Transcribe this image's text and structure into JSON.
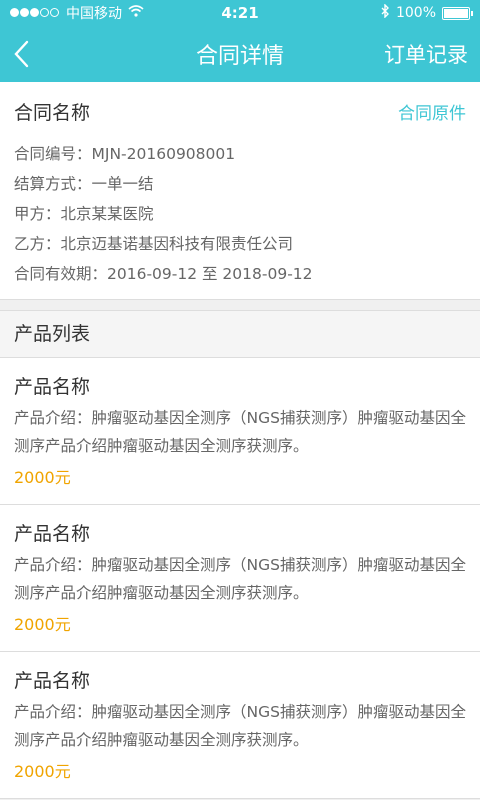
{
  "status": {
    "carrier": "中国移动",
    "time": "4:21",
    "battery": "100%"
  },
  "nav": {
    "title": "合同详情",
    "right_link": "订单记录"
  },
  "contract": {
    "name": "合同名称",
    "original_link": "合同原件",
    "rows": [
      "合同编号：MJN-20160908001",
      "结算方式：一单一结",
      "甲方：北京某某医院",
      "乙方：北京迈基诺基因科技有限责任公司",
      "合同有效期：2016-09-12 至 2018-09-12"
    ]
  },
  "product_list": {
    "heading": "产品列表",
    "items": [
      {
        "name": "产品名称",
        "desc": "产品介绍：肿瘤驱动基因全测序（NGS捕获测序）肿瘤驱动基因全测序产品介绍肿瘤驱动基因全测序获测序。",
        "price": "2000元"
      },
      {
        "name": "产品名称",
        "desc": "产品介绍：肿瘤驱动基因全测序（NGS捕获测序）肿瘤驱动基因全测序产品介绍肿瘤驱动基因全测序获测序。",
        "price": "2000元"
      },
      {
        "name": "产品名称",
        "desc": "产品介绍：肿瘤驱动基因全测序（NGS捕获测序）肿瘤驱动基因全测序产品介绍肿瘤驱动基因全测序获测序。",
        "price": "2000元"
      }
    ]
  },
  "colors": {
    "accent": "#3ec6d4",
    "price": "#f0a400"
  }
}
